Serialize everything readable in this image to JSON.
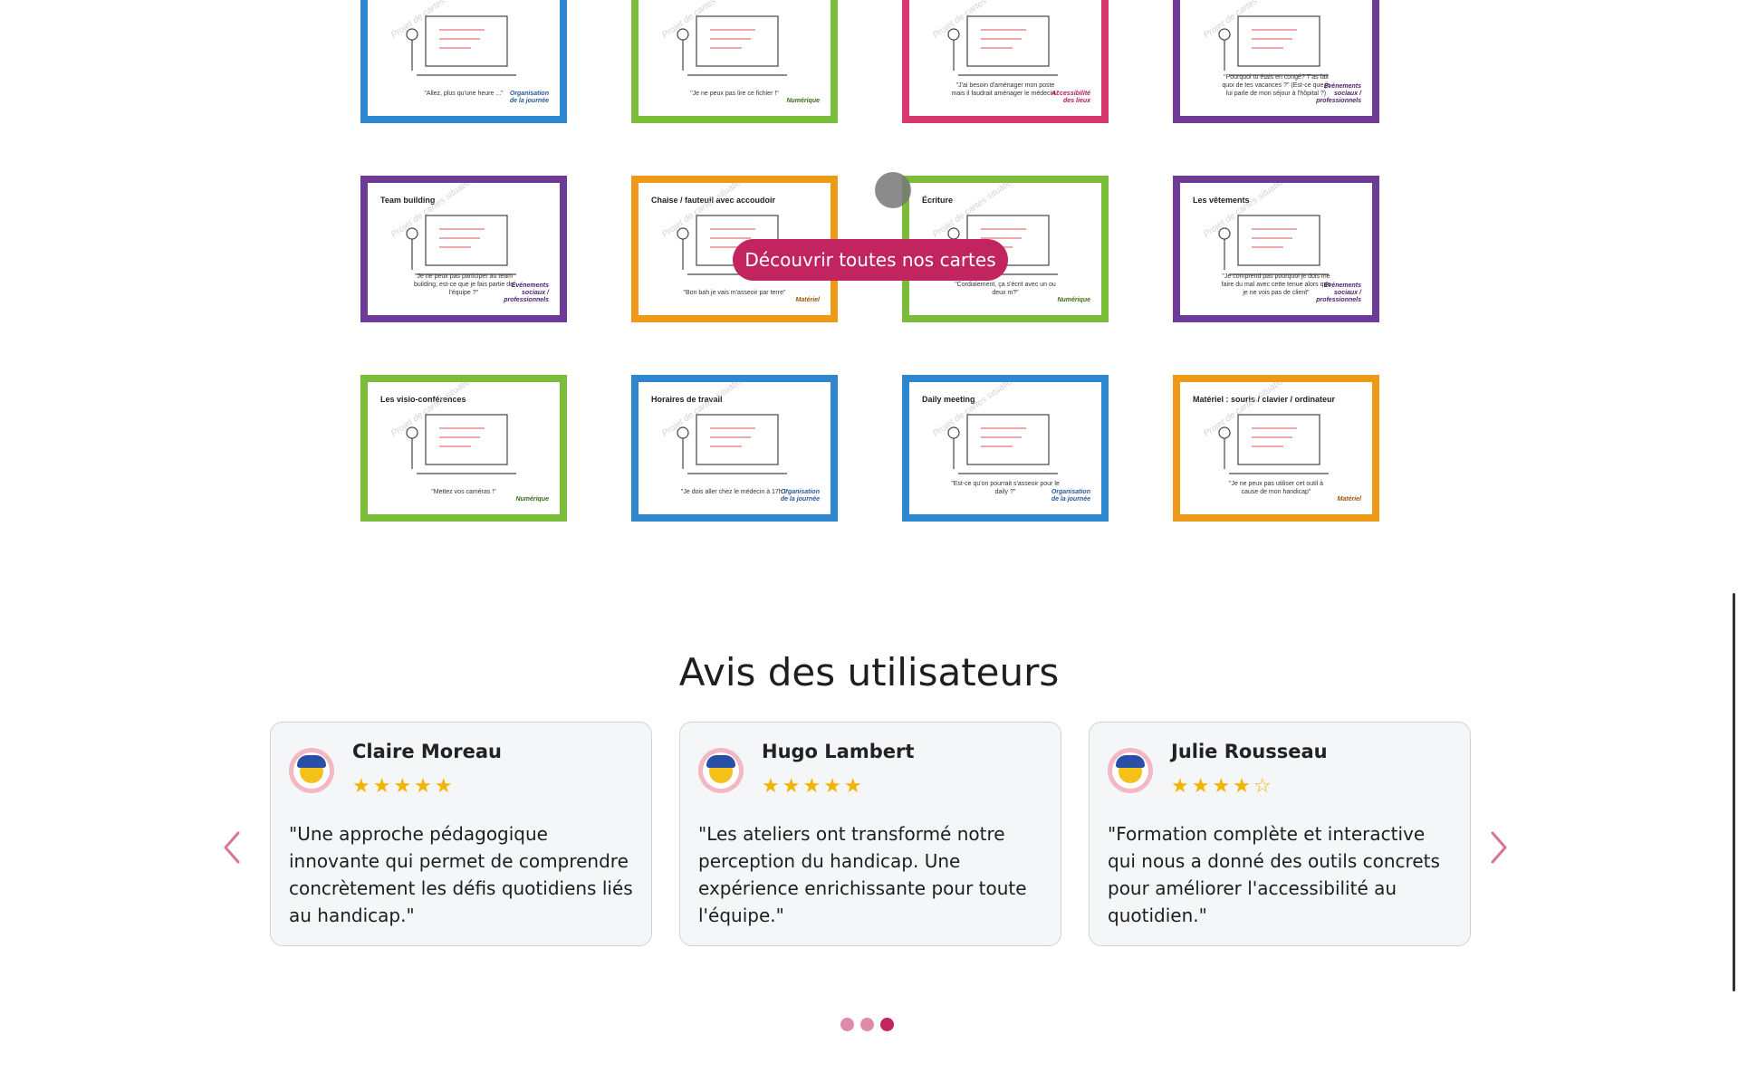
{
  "cards": [
    {
      "title": "",
      "caption": "\"Allez, plus qu'une heure ...\"",
      "category": "Organisation\nde la journée",
      "color": "blue"
    },
    {
      "title": "",
      "caption": "\"Je ne peux pas lire ce fichier !\"",
      "category": "Numérique",
      "color": "green"
    },
    {
      "title": "",
      "caption": "\"J'ai besoin d'aménager mon poste mais il faudrait aménager le médecin.\"",
      "category": "Accessibilité\ndes lieux",
      "color": "pink"
    },
    {
      "title": "",
      "caption": "\"Pourquoi tu étais en congé? T'as fait quoi de tes vacances ?\" (Est-ce que je lui parle de mon séjour à l'hôpital ?)",
      "category": "Événements\nsociaux /\nprofessionnels",
      "color": "purple"
    },
    {
      "title": "Team building",
      "caption": "\"Je ne peux pas participer au team building, est-ce que je fais partie de l'équipe ?\"",
      "category": "Événements\nsociaux /\nprofessionnels",
      "color": "purple"
    },
    {
      "title": "Chaise / fauteuil avec accoudoir",
      "caption": "\"Bon bah je vais m'asseoir par terre\"",
      "category": "Matériel",
      "color": "orange"
    },
    {
      "title": "Écriture",
      "caption": "\"Cordialement, ça s'écrit avec un ou deux m?\"",
      "category": "Numérique",
      "color": "green"
    },
    {
      "title": "Les vêtements",
      "caption": "\"Je comprend pas pourquoi je dois me faire du mal avec cette tenue alors que je ne vois pas de client\"",
      "category": "Événements\nsociaux /\nprofessionnels",
      "color": "purple"
    },
    {
      "title": "Les visio-conférences",
      "caption": "\"Mettez vos caméras !\"",
      "category": "Numérique",
      "color": "green"
    },
    {
      "title": "Horaires de travail",
      "caption": "\"Je dois aller chez le médecin à 17h !\"",
      "category": "Organisation\nde la journée",
      "color": "blue"
    },
    {
      "title": "Daily meeting",
      "caption": "\"Est-ce qu'on pourrait s'asseoir pour le daily ?\"",
      "category": "Organisation\nde la journée",
      "color": "blue"
    },
    {
      "title": "Matériel : souris / clavier / ordinateur",
      "caption": "\"Je ne peux pas utiliser cet outil à cause de mon handicap\"",
      "category": "Matériel",
      "color": "orange"
    }
  ],
  "watermark": "Projet de cartes situationnelles sur le handicap",
  "discover_button": "Découvrir toutes nos cartes",
  "reviews_title": "Avis des utilisateurs",
  "reviews": [
    {
      "name": "Claire Moreau",
      "stars": "★★★★★",
      "rating": 5,
      "text": "\"Une approche pédagogique innovante qui permet de comprendre concrètement les défis quotidiens liés au handicap.\""
    },
    {
      "name": "Hugo Lambert",
      "stars": "★★★★★",
      "rating": 5,
      "text": "\"Les ateliers ont transformé notre perception du handicap. Une expérience enrichissante pour toute l'équipe.\""
    },
    {
      "name": "Julie Rousseau",
      "stars": "★★★★☆",
      "rating": 4,
      "text": "\"Formation complète et interactive qui nous a donné des outils concrets pour améliorer l'accessibilité au quotidien.\""
    }
  ],
  "carousel": {
    "active_dot": 3,
    "dot_count": 3
  },
  "colors": {
    "accent": "#c2245f",
    "blue": "#2e86cf",
    "green": "#7bbd3a",
    "pink": "#d6386f",
    "purple": "#6d3a96",
    "orange": "#ee9a18",
    "star": "#f2b400"
  },
  "icons": {
    "prev": "chevron-left-icon",
    "next": "chevron-right-icon"
  }
}
